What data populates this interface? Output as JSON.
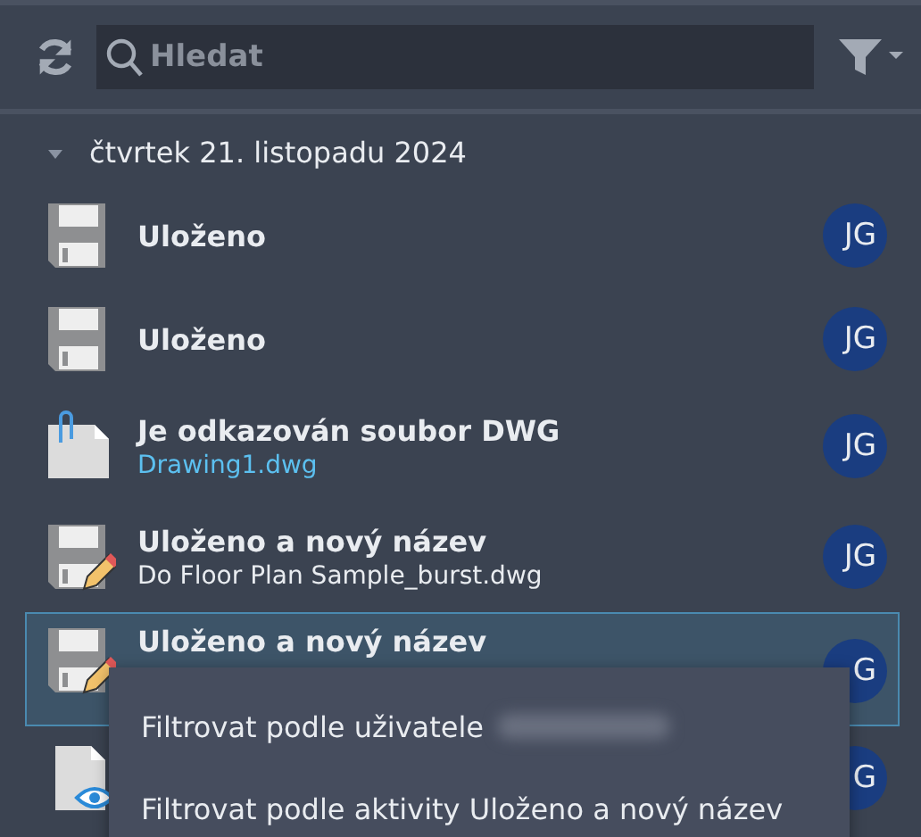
{
  "toolbar": {
    "search": {
      "placeholder": "Hledat"
    }
  },
  "groups": [
    {
      "date": "čtvrtek 21. listopadu 2024",
      "expanded": true,
      "items": [
        {
          "kind": "saved",
          "title": "Uloženo",
          "avatar": "JG",
          "selected": false
        },
        {
          "kind": "saved",
          "title": "Uloženo",
          "avatar": "JG",
          "selected": false
        },
        {
          "kind": "reference",
          "title": "Je odkazován soubor DWG",
          "link": "Drawing1.dwg",
          "avatar": "JG",
          "selected": false
        },
        {
          "kind": "renamed",
          "title": "Uloženo a nový název",
          "subtitle": "Do Floor Plan Sample_burst.dwg",
          "avatar": "JG",
          "selected": false
        },
        {
          "kind": "renamed",
          "title": "Uloženo a nový název",
          "avatar": "G",
          "selected": true
        },
        {
          "kind": "viewed",
          "avatar": "G",
          "selected": false
        }
      ]
    }
  ],
  "context_menu": {
    "items": [
      {
        "label": "Filtrovat podle uživatele",
        "redacted": true
      },
      {
        "label": "Filtrovat podle aktivity Uloženo a nový název",
        "redacted": false
      }
    ]
  }
}
